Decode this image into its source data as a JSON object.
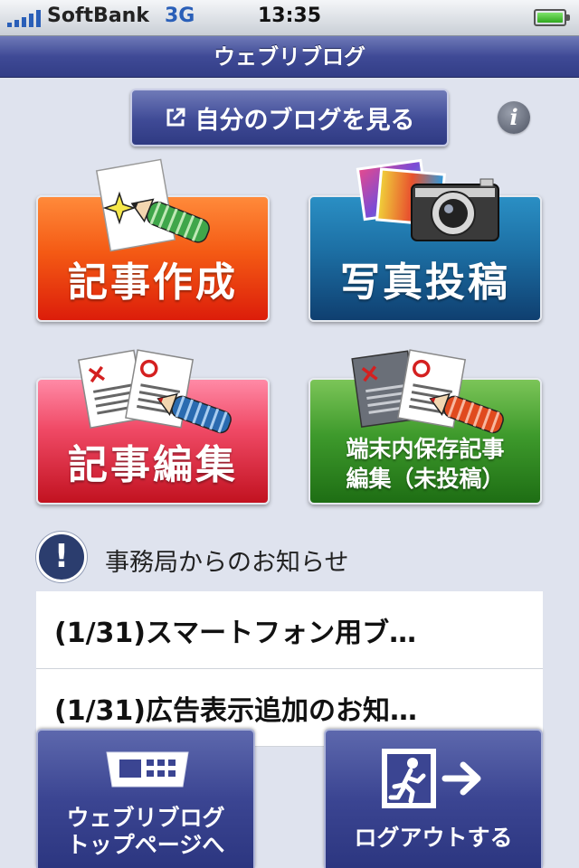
{
  "status_bar": {
    "carrier": "SoftBank",
    "network": "3G",
    "time": "13:35",
    "signal_bars": 5,
    "battery_level": 1.0,
    "signal_color": "#2a5fb8",
    "battery_color": "#3cbf2b"
  },
  "header": {
    "title": "ウェブリブログ"
  },
  "toolbar": {
    "view_blog_label": "自分のブログを見る",
    "view_blog_icon": "external-link-icon",
    "info_label": "i",
    "info_icon": "info-icon"
  },
  "tiles": [
    {
      "id": "create",
      "label": "記事作成",
      "icon": "paper-pencil-sparkle-icon",
      "color": "#f0480f"
    },
    {
      "id": "photo",
      "label": "写真投稿",
      "icon": "camera-photos-icon",
      "color": "#1c5f95"
    },
    {
      "id": "edit",
      "label": "記事編集",
      "icon": "papers-pencil-edit-icon",
      "color": "#e63a55"
    },
    {
      "id": "local",
      "label_line1": "端末内保存記事",
      "label_line2": "編集（未投稿）",
      "icon": "saved-papers-pencil-icon",
      "color": "#2f8a22"
    }
  ],
  "notices": {
    "heading": "事務局からのお知らせ",
    "icon": "exclamation-icon",
    "items": [
      "(1/31)スマートフォン用ブ…",
      "(1/31)広告表示追加のお知…"
    ]
  },
  "bottom_nav": {
    "top_label_line1": "ウェブリブログ",
    "top_label_line2": "トップページへ",
    "top_icon": "keyboard-device-icon",
    "logout_label": "ログアウトする",
    "logout_icon": "exit-door-icon"
  },
  "colors": {
    "accent_navy": "#3f4a96",
    "background": "#dfe3ee"
  }
}
